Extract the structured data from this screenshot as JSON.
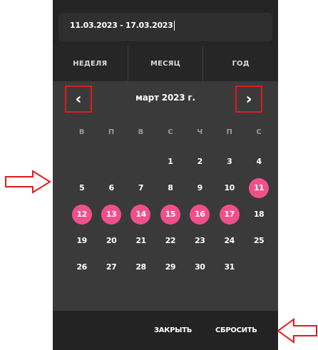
{
  "date_range": "11.03.2023 - 17.03.2023",
  "tabs": [
    "НЕДЕЛЯ",
    "МЕСЯЦ",
    "ГОД"
  ],
  "month_title": "март 2023 г.",
  "nav": {
    "prev": "‹",
    "next": "›"
  },
  "weekdays": [
    "В",
    "П",
    "В",
    "С",
    "Ч",
    "П",
    "С"
  ],
  "days": [
    {
      "label": "",
      "selected": false
    },
    {
      "label": "",
      "selected": false
    },
    {
      "label": "",
      "selected": false
    },
    {
      "label": "1",
      "selected": false
    },
    {
      "label": "2",
      "selected": false
    },
    {
      "label": "3",
      "selected": false
    },
    {
      "label": "4",
      "selected": false
    },
    {
      "label": "5",
      "selected": false
    },
    {
      "label": "6",
      "selected": false
    },
    {
      "label": "7",
      "selected": false
    },
    {
      "label": "8",
      "selected": false
    },
    {
      "label": "9",
      "selected": false
    },
    {
      "label": "10",
      "selected": false
    },
    {
      "label": "11",
      "selected": true
    },
    {
      "label": "12",
      "selected": true
    },
    {
      "label": "13",
      "selected": true
    },
    {
      "label": "14",
      "selected": true
    },
    {
      "label": "15",
      "selected": true
    },
    {
      "label": "16",
      "selected": true
    },
    {
      "label": "17",
      "selected": true
    },
    {
      "label": "18",
      "selected": false
    },
    {
      "label": "19",
      "selected": false
    },
    {
      "label": "20",
      "selected": false
    },
    {
      "label": "21",
      "selected": false
    },
    {
      "label": "22",
      "selected": false
    },
    {
      "label": "23",
      "selected": false
    },
    {
      "label": "24",
      "selected": false
    },
    {
      "label": "25",
      "selected": false
    },
    {
      "label": "26",
      "selected": false
    },
    {
      "label": "27",
      "selected": false
    },
    {
      "label": "28",
      "selected": false
    },
    {
      "label": "29",
      "selected": false
    },
    {
      "label": "30",
      "selected": false
    },
    {
      "label": "31",
      "selected": false
    }
  ],
  "footer": {
    "close": "ЗАКРЫТЬ",
    "reset": "СБРОСИТЬ"
  },
  "colors": {
    "accent": "#f0508a",
    "highlight": "#e01b1b",
    "panel": "#3a3a3a"
  },
  "icons": {
    "prev": "chevron-left-icon",
    "next": "chevron-right-icon",
    "annotation": "outline-arrow-icon"
  }
}
